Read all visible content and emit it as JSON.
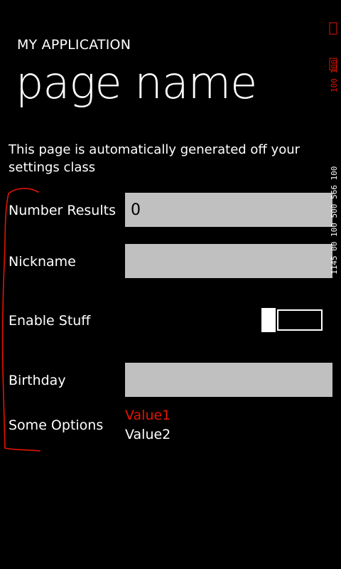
{
  "header": {
    "app_title": "MY APPLICATION",
    "page_title": "page name"
  },
  "description": "This page is automatically generated off your settings class",
  "settings": {
    "number_results": {
      "label": "Number Results",
      "value": "0"
    },
    "nickname": {
      "label": "Nickname",
      "value": ""
    },
    "enable_stuff": {
      "label": "Enable Stuff",
      "on": false
    },
    "birthday": {
      "label": "Birthday",
      "value": ""
    },
    "some_options": {
      "label": "Some Options",
      "options": [
        "Value1",
        "Value2"
      ],
      "selected": "Value1"
    }
  },
  "debug_overlay": {
    "text_top": "100 100",
    "text_bottom": "1145 00 100 500 566 100"
  },
  "colors": {
    "background": "#000000",
    "textbox": "#c0c0c0",
    "accent": "#e51400"
  }
}
